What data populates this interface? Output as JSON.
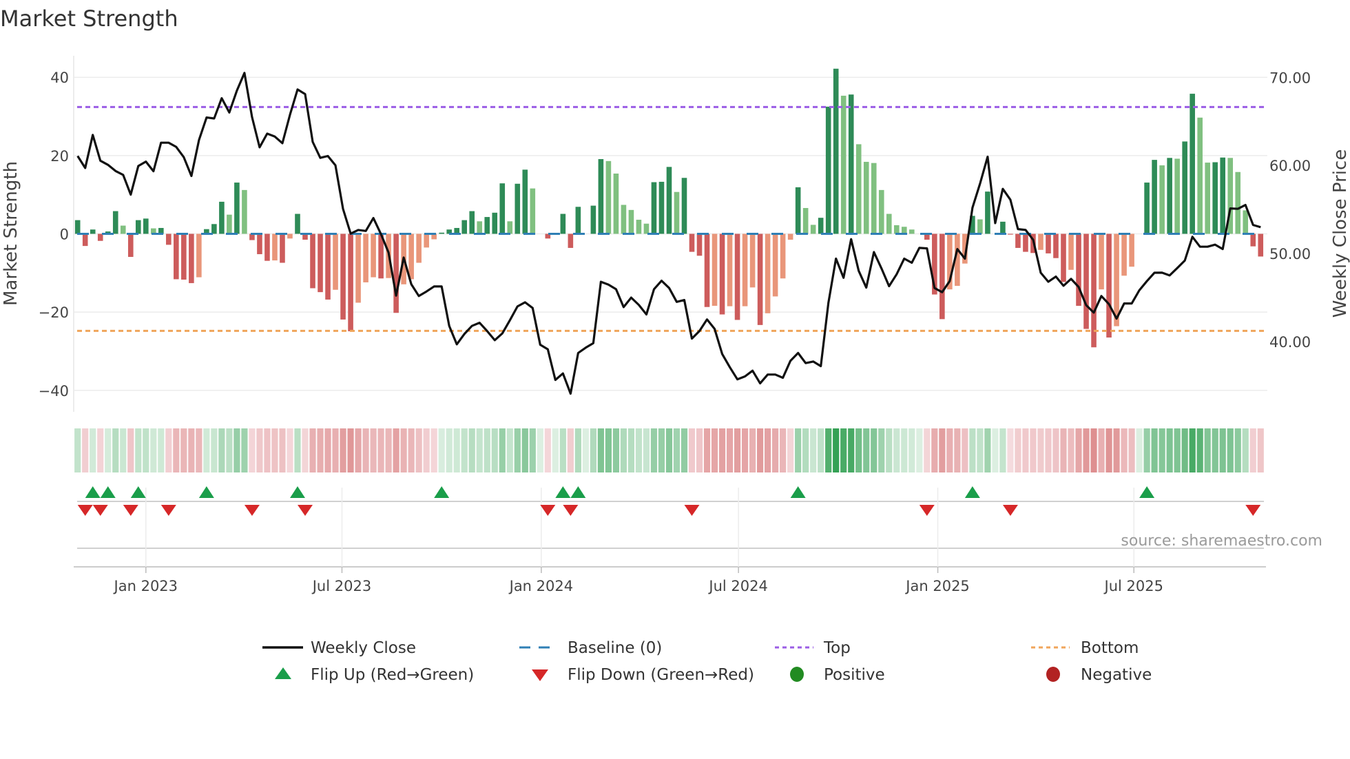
{
  "chart_data": {
    "type": "bar",
    "title": "Market Strength",
    "ylabel": "Market Strength",
    "y2label": "Weekly Close Price",
    "ylim": [
      -45.5,
      45.5
    ],
    "y2lim": [
      32.0,
      72.46
    ],
    "yticks": [
      40,
      20,
      0,
      -20,
      -40
    ],
    "ytick_labels": [
      "40",
      "20",
      "0",
      "−20",
      "−40"
    ],
    "y2ticks": [
      70,
      60,
      50,
      40
    ],
    "y2tick_labels": [
      "70.00",
      "60.00",
      "50.00",
      "40.00"
    ],
    "xticks": [
      {
        "label": "Jan 2023",
        "date": "2023-01-01"
      },
      {
        "label": "Jul 2023",
        "date": "2023-07-01"
      },
      {
        "label": "Jan 2024",
        "date": "2024-01-01"
      },
      {
        "label": "Jul 2024",
        "date": "2024-07-01"
      },
      {
        "label": "Jan 2025",
        "date": "2025-01-01"
      },
      {
        "label": "Jul 2025",
        "date": "2025-07-01"
      }
    ],
    "top_level": 32.4,
    "bottom_level": -24.8,
    "baseline": 0,
    "grid": true,
    "legend_placement": "bottom-center",
    "strength": [
      3.5,
      -3.1,
      1.1,
      -1.8,
      0.6,
      5.8,
      2.1,
      -5.9,
      3.5,
      3.9,
      1.4,
      1.5,
      -2.8,
      -11.6,
      -11.7,
      -12.6,
      -11.1,
      1.2,
      2.5,
      8.2,
      4.9,
      13.1,
      11.2,
      -1.6,
      -5.2,
      -6.9,
      -6.8,
      -7.4,
      -1.2,
      5.1,
      -1.5,
      -13.9,
      -14.9,
      -16.8,
      -14.3,
      -21.9,
      -24.9,
      -17.6,
      -12.4,
      -11.1,
      -11.4,
      -11.3,
      -20.2,
      -12.9,
      -11.6,
      -7.4,
      -3.5,
      -1.4,
      0.3,
      1.1,
      1.5,
      3.5,
      5.8,
      3.2,
      4.3,
      5.4,
      12.9,
      3.2,
      12.8,
      16.4,
      11.6,
      0,
      -1.2,
      0,
      5.1,
      -3.6,
      6.9,
      0,
      7.2,
      19.1,
      18.6,
      15.4,
      7.4,
      6.1,
      3.6,
      2.6,
      13.2,
      13.3,
      17.1,
      10.7,
      14.3,
      -4.6,
      -5.6,
      -18.7,
      -18.4,
      -20.6,
      -18.5,
      -22,
      -18.5,
      -13.7,
      -23.3,
      -20.3,
      -16,
      -11.4,
      -1.5,
      11.9,
      6.6,
      2.3,
      4.1,
      32.5,
      42.2,
      35.3,
      35.6,
      22.9,
      18.4,
      18.1,
      11.2,
      5.1,
      2.2,
      1.8,
      1.1,
      0,
      -1.5,
      -15.5,
      -21.8,
      -14.2,
      -13.3,
      -7.6,
      4.6,
      3.7,
      10.8,
      0,
      3.1,
      -0.2,
      -3.6,
      -4.6,
      -4.9,
      -4.1,
      -5.0,
      -6.2,
      -12.3,
      -9.2,
      -18.4,
      -24.3,
      -29,
      -14.2,
      -26.5,
      -23.6,
      -10.7,
      -8.4,
      0,
      13.1,
      18.9,
      17.5,
      19.4,
      19.2,
      23.6,
      35.8,
      29.7,
      18.2,
      18.3,
      19.5,
      19.4,
      15.8,
      6,
      -3.2,
      -5.8
    ],
    "weekly_close": [
      61.07,
      59.71,
      63.47,
      60.54,
      60.07,
      59.37,
      58.93,
      56.68,
      59.94,
      60.44,
      59.34,
      62.58,
      62.58,
      62.11,
      60.94,
      58.8,
      62.89,
      65.45,
      65.34,
      67.64,
      66.02,
      68.5,
      70.51,
      65.5,
      62.06,
      63.62,
      63.28,
      62.53,
      65.76,
      68.63,
      68.11,
      62.68,
      60.86,
      61.07,
      60.02,
      55.07,
      52.25,
      52.67,
      52.56,
      54.02,
      52.2,
      50.11,
      45.21,
      49.54,
      46.51,
      45.16,
      45.68,
      46.25,
      46.25,
      41.77,
      39.68,
      40.85,
      41.77,
      42.13,
      41.19,
      40.15,
      40.91,
      42.42,
      43.98,
      44.45,
      43.8,
      39.63,
      39.11,
      35.63,
      36.37,
      34.07,
      38.69,
      39.29,
      39.81,
      46.78,
      46.46,
      45.94,
      43.9,
      44.98,
      44.16,
      43.07,
      45.94,
      46.9,
      46.07,
      44.5,
      44.71,
      40.33,
      41.19,
      42.5,
      41.43,
      38.58,
      37.07,
      35.69,
      36.03,
      36.68,
      35.24,
      36.24,
      36.24,
      35.87,
      37.8,
      38.69,
      37.54,
      37.72,
      37.2,
      44.37,
      49.41,
      47.24,
      51.62,
      48.03,
      46.12,
      50.16,
      48.29,
      46.28,
      47.64,
      49.41,
      48.94,
      50.63,
      50.58,
      46.07,
      45.6,
      46.85,
      50.5,
      49.41,
      55.2,
      57.94,
      60.99,
      53.45,
      57.34,
      56.11,
      52.77,
      52.67,
      51.55,
      47.81,
      46.78,
      47.37,
      46.33,
      47.11,
      46.2,
      44.12,
      43.28,
      45.16,
      44.24,
      42.6,
      44.32,
      44.32,
      45.81,
      46.85,
      47.81,
      47.82,
      47.5,
      48.34,
      49.2,
      51.89,
      50.77,
      50.77,
      51.0,
      50.5,
      55.12,
      55.07,
      55.51,
      53.24,
      52.98
    ],
    "legend": {
      "weekly_close": "Weekly Close",
      "baseline": "Baseline (0)",
      "top": "Top",
      "bottom": "Bottom",
      "flip_up": "Flip Up (Red→Green)",
      "flip_down": "Flip Down (Green→Red)",
      "positive": "Positive",
      "negative": "Negative"
    },
    "source": "source: sharemaestro.com",
    "colors": {
      "pos_strong": "#2e8b57",
      "pos_weak": "#80c080",
      "neg_strong": "#cd5c5c",
      "neg_weak": "#e9967a",
      "close": "#111111",
      "baseline": "#2f7fb5",
      "top": "#9b5de5",
      "bottom": "#f0a55a",
      "flip_up": "#1a9e4a",
      "flip_down": "#d62728",
      "positive": "#228b22",
      "negative": "#b22222"
    }
  }
}
